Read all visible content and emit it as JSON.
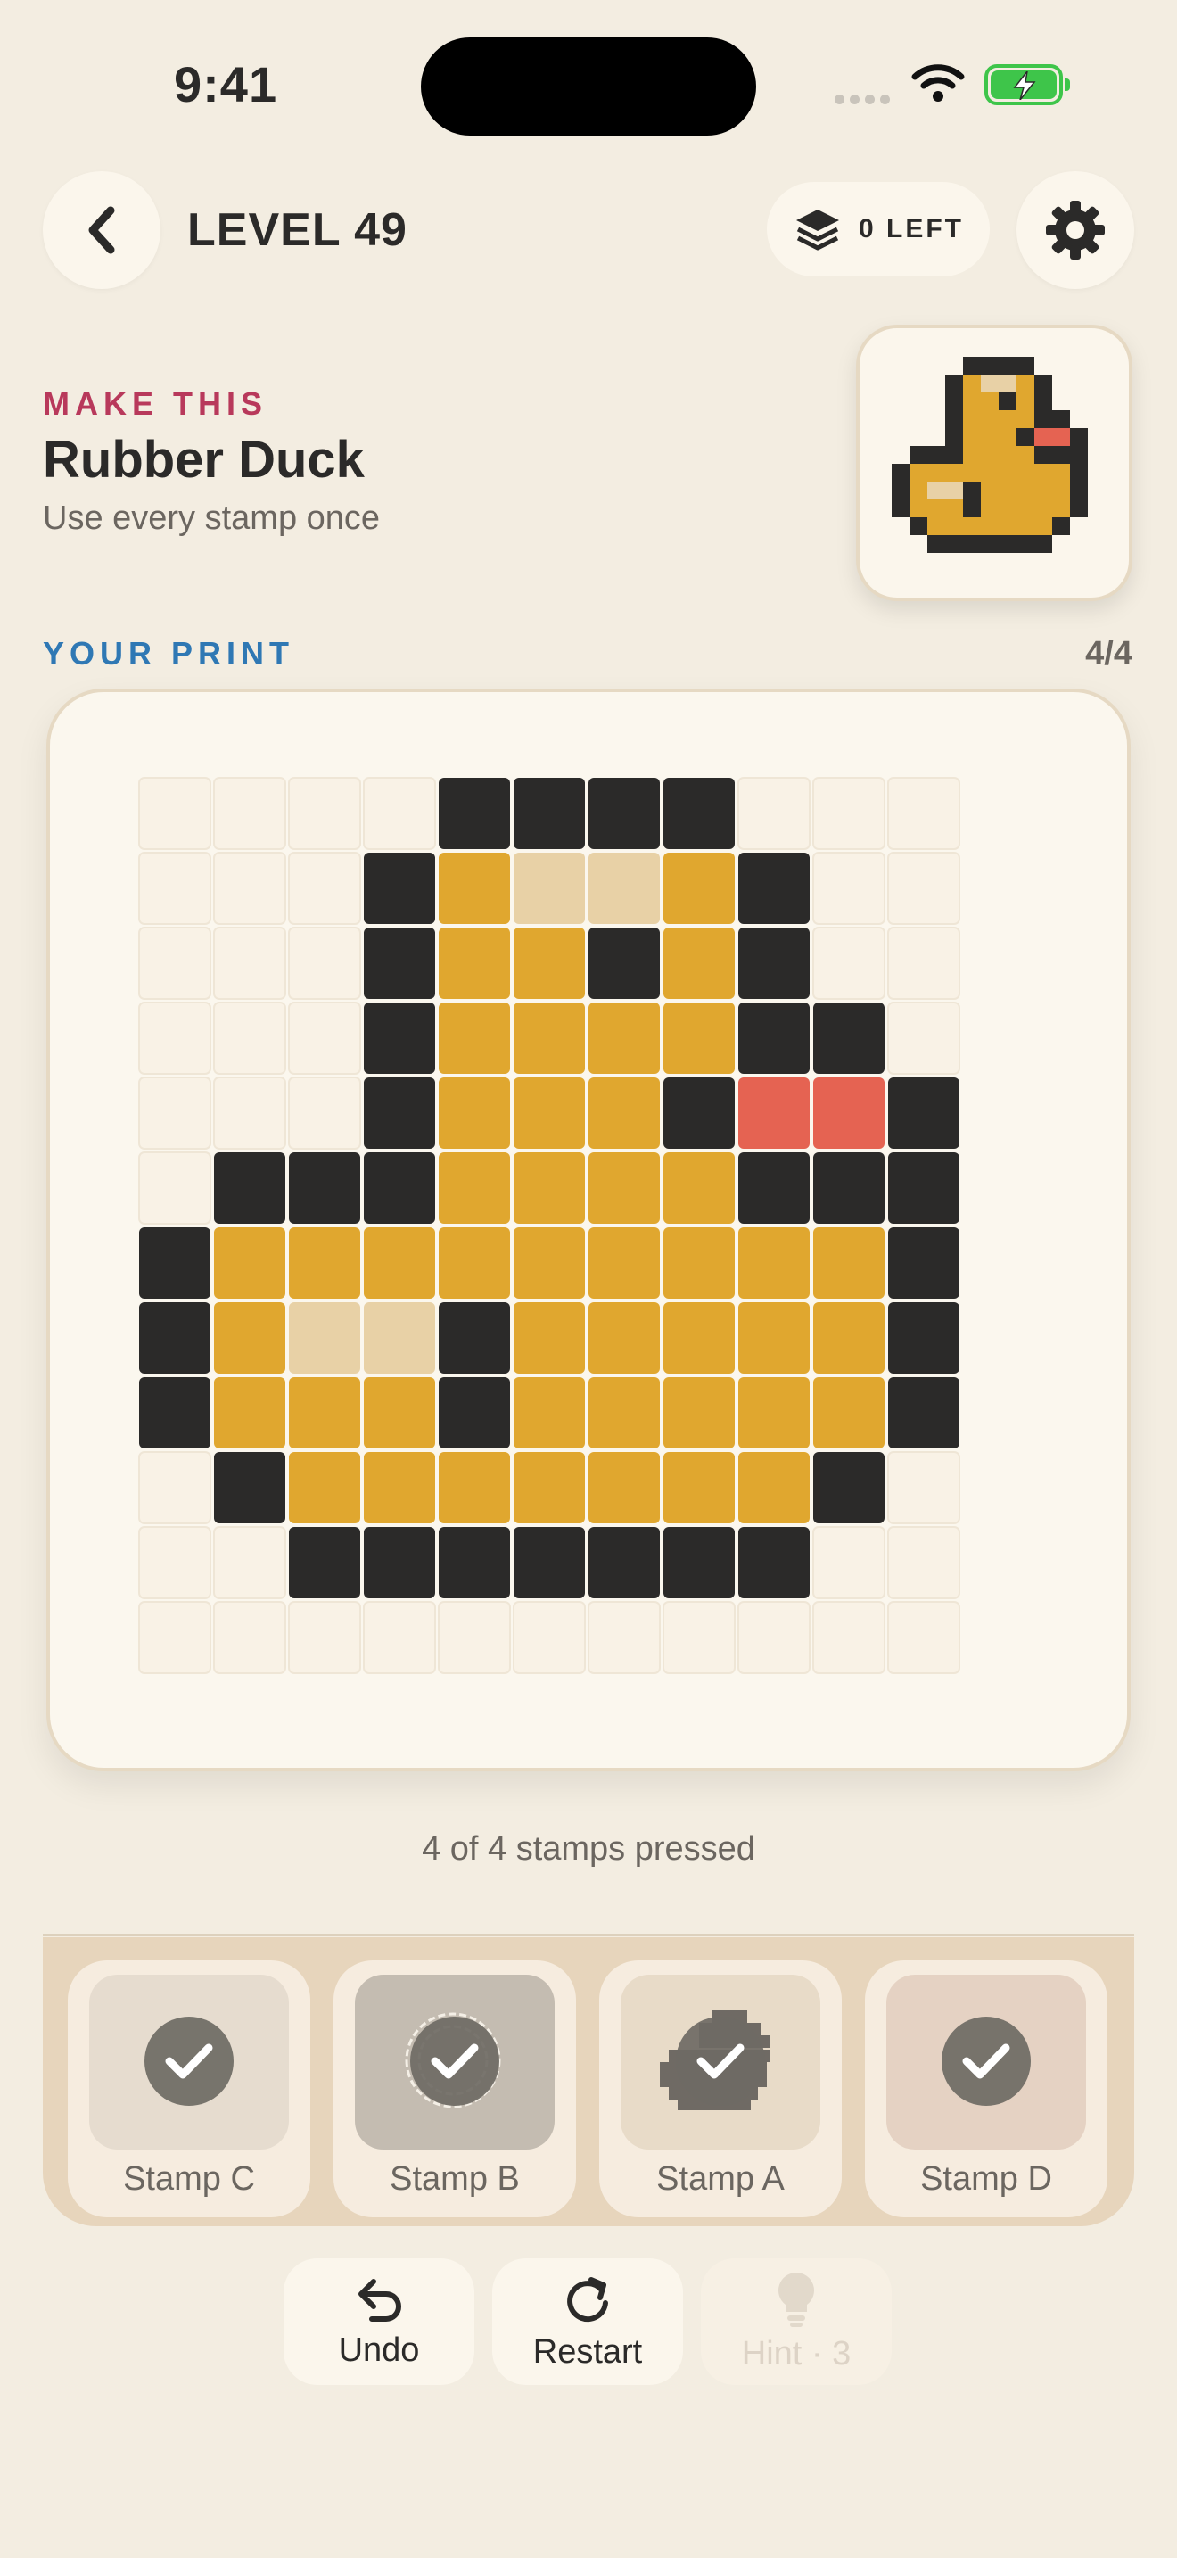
{
  "status": {
    "time": "9:41"
  },
  "header": {
    "level": "LEVEL 49",
    "stamps_left": "0 LEFT"
  },
  "target": {
    "label": "MAKE THIS",
    "name": "Rubber Duck",
    "hint": "Use every stamp once"
  },
  "print": {
    "label": "YOUR PRINT",
    "count": "4/4",
    "pressed_text": "4 of 4 stamps pressed"
  },
  "colors": {
    "K": "#2b2a29",
    "Y": "#e0a72f",
    "L": "#e8d1a6",
    "R": "#e56352",
    "empty": "#f9f2e6"
  },
  "grid": [
    "....KKKK...",
    "...KYLLYK..",
    "...KYYKYK..",
    "...KYYYYKK.",
    "...KYYYKRRK",
    ".KKKYYYYKKK",
    "KYYYYYYYYYK",
    "KYLLKYYYYYK",
    "KYYYKYYYYYK",
    ".KYYYYYYYK.",
    "..KKKKKKK..",
    "..........."
  ],
  "stamps": [
    {
      "label": "Stamp C",
      "tint": "#e6dccf"
    },
    {
      "label": "Stamp B",
      "tint": "#c4bcb1"
    },
    {
      "label": "Stamp A",
      "tint": "#e8dbc8"
    },
    {
      "label": "Stamp D",
      "tint": "#e5d2c3"
    }
  ],
  "actions": {
    "undo": "Undo",
    "restart": "Restart",
    "hint": "Hint · 3"
  }
}
